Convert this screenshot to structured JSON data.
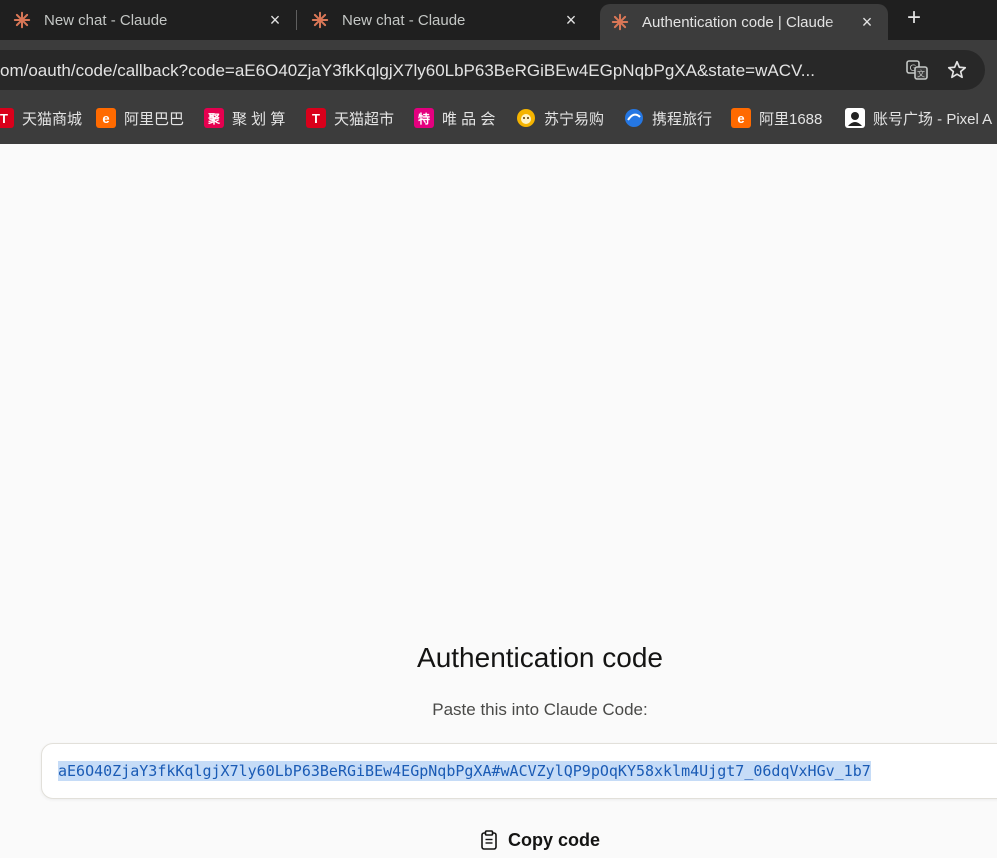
{
  "tabs": [
    {
      "title": "New chat - Claude",
      "close": "×"
    },
    {
      "title": "New chat - Claude",
      "close": "×"
    },
    {
      "title": "Authentication code | Claude",
      "close": "×"
    }
  ],
  "new_tab": "+",
  "address_bar": {
    "url": "om/oauth/code/callback?code=aE6O40ZjaY3fkKqlgjX7ly60LbP63BeRGiBEw4EGpNqbPgXA&state=wACV..."
  },
  "bookmarks": [
    {
      "label": "天猫商城",
      "icon_text": "T",
      "color": "#d9001b"
    },
    {
      "label": "阿里巴巴",
      "icon_text": "e",
      "color": "#ff6a00"
    },
    {
      "label": "聚 划 算",
      "icon_text": "聚",
      "color": "#e5004f"
    },
    {
      "label": "天猫超市",
      "icon_text": "T",
      "color": "#d9001b"
    },
    {
      "label": "唯 品 会",
      "icon_text": "特",
      "color": "#e4007f"
    },
    {
      "label": "苏宁易购",
      "icon_text": "",
      "color": "#f5b400"
    },
    {
      "label": "携程旅行",
      "icon_text": "",
      "color": "#2577e3"
    },
    {
      "label": "阿里1688",
      "icon_text": "e",
      "color": "#ff6a00"
    },
    {
      "label": "账号广场 - Pixel A",
      "icon_text": "",
      "color": "#ffffff"
    }
  ],
  "page": {
    "heading": "Authentication code",
    "subtext": "Paste this into Claude Code:",
    "code": "aE6O40ZjaY3fkKqlgjX7ly60LbP63BeRGiBEw4EGpNqbPgXA#wACVZylQP9pOqKY58xklm4Ujgt7_06dqVxHGv_1b7",
    "copy_label": "Copy code"
  },
  "colors": {
    "claude_accent": "#d97757",
    "code_text": "#1a5bb5",
    "code_highlight": "#c6dcf7"
  }
}
